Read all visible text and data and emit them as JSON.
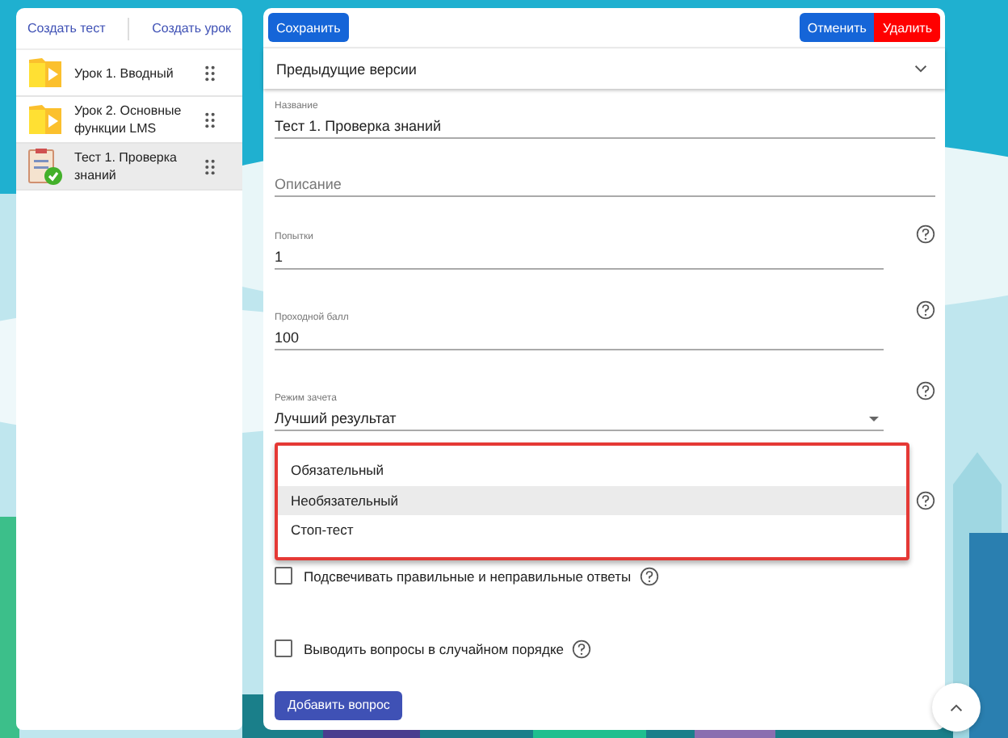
{
  "sidebar": {
    "actions": [
      "Создать тест",
      "Создать урок"
    ],
    "items": [
      {
        "kind": "lesson",
        "title": "Урок 1. Вводный",
        "selected": false
      },
      {
        "kind": "lesson",
        "title": "Урок 2. Основные функции LMS",
        "selected": false
      },
      {
        "kind": "test",
        "title": "Тест 1. Проверка знаний",
        "selected": true
      }
    ]
  },
  "toolbar": {
    "save": "Сохранить",
    "cancel": "Отменить",
    "delete": "Удалить"
  },
  "versions": {
    "label": "Предыдущие версии",
    "expanded": false
  },
  "fields": [
    {
      "kind": "text",
      "label": "Название",
      "value": "Тест 1. Проверка знаний",
      "help": false
    },
    {
      "kind": "text",
      "placeholder": "Описание",
      "help": false
    },
    {
      "kind": "text",
      "label": "Попытки",
      "value": "1",
      "help": true
    },
    {
      "kind": "text",
      "label": "Проходной балл",
      "value": "100",
      "help": true
    },
    {
      "kind": "select",
      "label": "Режим зачета",
      "value": "Лучший результат",
      "help": true
    },
    {
      "kind": "menu",
      "help": true,
      "options": [
        {
          "label": "Обязательный",
          "selected": false
        },
        {
          "label": "Необязательный",
          "selected": true
        },
        {
          "label": "Стоп-тест",
          "selected": false
        }
      ]
    }
  ],
  "checkboxes": [
    {
      "label": "Подсвечивать правильные и неправильные ответы",
      "checked": false
    },
    {
      "label": "Выводить вопросы в случайном порядке",
      "checked": false
    }
  ],
  "add_button": "Добавить вопрос"
}
